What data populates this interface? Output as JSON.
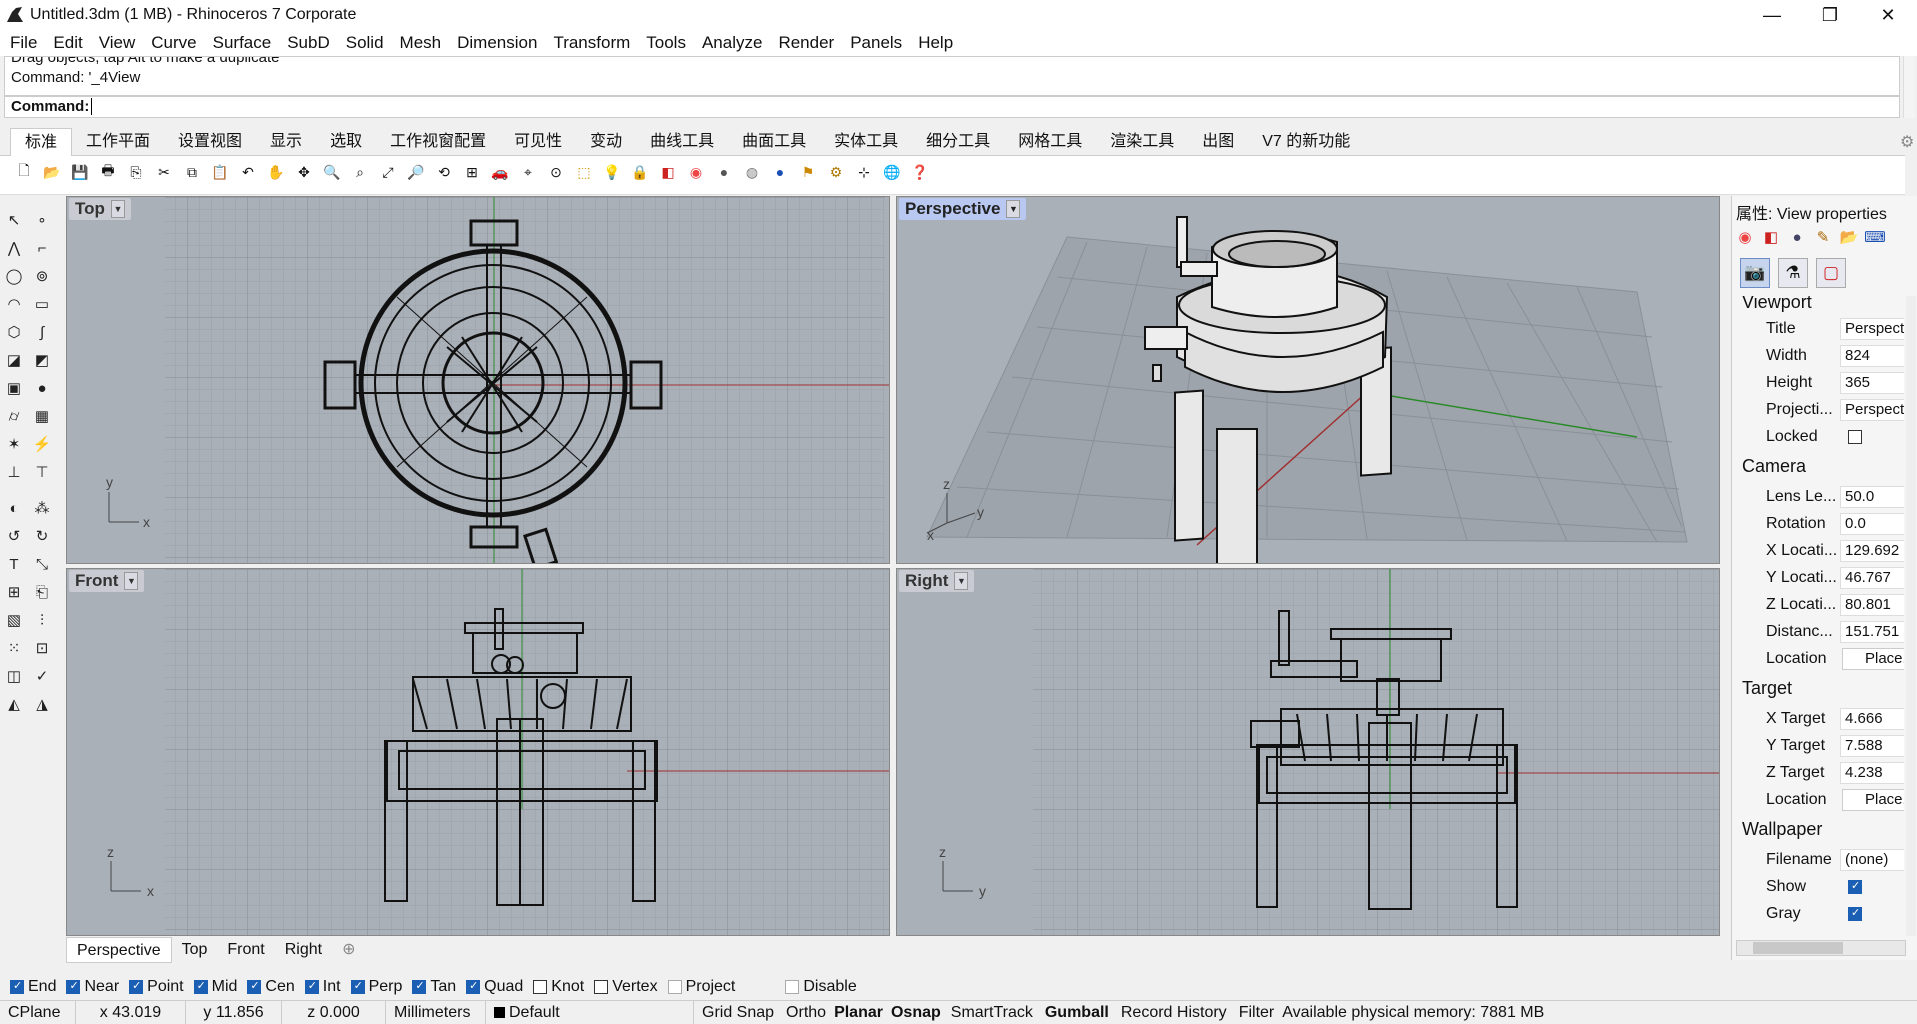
{
  "window": {
    "title": "Untitled.3dm (1 MB) - Rhinoceros 7 Corporate",
    "minimize": "—",
    "maximize": "❐",
    "close": "✕"
  },
  "menu": [
    "File",
    "Edit",
    "View",
    "Curve",
    "Surface",
    "SubD",
    "Solid",
    "Mesh",
    "Dimension",
    "Transform",
    "Tools",
    "Analyze",
    "Render",
    "Panels",
    "Help"
  ],
  "command": {
    "history1": "Drag objects, tap Alt to make a duplicate",
    "history2": "Command: '_4View",
    "prompt": "Command:"
  },
  "tabs": [
    "标准",
    "工作平面",
    "设置视图",
    "显示",
    "选取",
    "工作视窗配置",
    "可见性",
    "变动",
    "曲线工具",
    "曲面工具",
    "实体工具",
    "细分工具",
    "网格工具",
    "渲染工具",
    "出图",
    "V7 的新功能"
  ],
  "viewports": {
    "top": "Top",
    "perspective": "Perspective",
    "front": "Front",
    "right": "Right"
  },
  "axes": {
    "x": "x",
    "y": "y",
    "z": "z"
  },
  "viewport_tabs": [
    "Perspective",
    "Top",
    "Front",
    "Right"
  ],
  "properties": {
    "title": "属性: View properties",
    "viewport_section": "Viewport",
    "camera_section": "Camera",
    "target_section": "Target",
    "wallpaper_section": "Wallpaper",
    "rows": {
      "title": {
        "k": "Title",
        "v": "Perspective"
      },
      "width": {
        "k": "Width",
        "v": "824"
      },
      "height": {
        "k": "Height",
        "v": "365"
      },
      "projection": {
        "k": "Projecti...",
        "v": "Perspective"
      },
      "locked": {
        "k": "Locked"
      },
      "lens": {
        "k": "Lens Le...",
        "v": "50.0"
      },
      "rotation": {
        "k": "Rotation",
        "v": "0.0"
      },
      "xloc": {
        "k": "X Locati...",
        "v": "129.692"
      },
      "yloc": {
        "k": "Y Locati...",
        "v": "46.767"
      },
      "zloc": {
        "k": "Z Locati...",
        "v": "80.801"
      },
      "distance": {
        "k": "Distanc...",
        "v": "151.751"
      },
      "location": {
        "k": "Location",
        "v": "Place..."
      },
      "xtarget": {
        "k": "X Target",
        "v": "4.666"
      },
      "ytarget": {
        "k": "Y Target",
        "v": "7.588"
      },
      "ztarget": {
        "k": "Z Target",
        "v": "4.238"
      },
      "tlocation": {
        "k": "Location",
        "v": "Place..."
      },
      "filename": {
        "k": "Filename",
        "v": "(none)"
      },
      "show": {
        "k": "Show"
      },
      "gray": {
        "k": "Gray"
      }
    }
  },
  "osnaps": [
    {
      "label": "End",
      "on": true
    },
    {
      "label": "Near",
      "on": true
    },
    {
      "label": "Point",
      "on": true
    },
    {
      "label": "Mid",
      "on": true
    },
    {
      "label": "Cen",
      "on": true
    },
    {
      "label": "Int",
      "on": true
    },
    {
      "label": "Perp",
      "on": true
    },
    {
      "label": "Tan",
      "on": true
    },
    {
      "label": "Quad",
      "on": true
    },
    {
      "label": "Knot",
      "on": false
    },
    {
      "label": "Vertex",
      "on": false
    },
    {
      "label": "Project",
      "on": false
    },
    {
      "label": "Disable",
      "on": false
    }
  ],
  "status": {
    "cplane": "CPlane",
    "x": "x 43.019",
    "y": "y 11.856",
    "z": "z 0.000",
    "units": "Millimeters",
    "layer": "Default",
    "grid_snap": "Grid Snap",
    "ortho": "Ortho",
    "planar": "Planar",
    "osnap": "Osnap",
    "smarttrack": "SmartTrack",
    "gumball": "Gumball",
    "record": "Record History",
    "filter": "Filter",
    "memory": "Available physical memory: 7881 MB"
  }
}
